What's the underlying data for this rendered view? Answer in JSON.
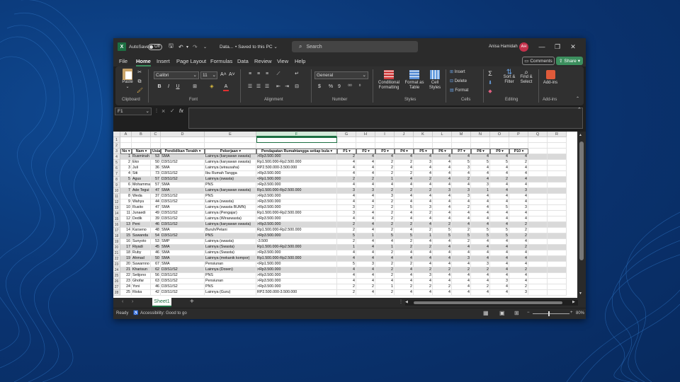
{
  "window": {
    "autosave_label": "AutoSave",
    "autosave_state": "Off",
    "file_name": "Data...",
    "save_status": "Saved to this PC",
    "search_placeholder": "Search",
    "user_name": "Anisa Hamidah",
    "user_initials": "AH"
  },
  "menu": {
    "tabs": [
      "File",
      "Home",
      "Insert",
      "Page Layout",
      "Formulas",
      "Data",
      "Review",
      "View",
      "Help"
    ],
    "active_tab": "Home",
    "comments_label": "Comments",
    "share_label": "Share"
  },
  "ribbon": {
    "clipboard": {
      "paste": "Paste",
      "label": "Clipboard"
    },
    "font": {
      "name": "Calibri",
      "size": "11",
      "label": "Font",
      "bold": "B",
      "italic": "I",
      "underline": "U"
    },
    "alignment": {
      "label": "Alignment"
    },
    "number": {
      "format": "General",
      "currency": "$",
      "percent": "%",
      "comma": "9",
      "label": "Number"
    },
    "styles": {
      "conditional": "Conditional Formatting",
      "format_table": "Format as Table",
      "cell_styles": "Cell Styles",
      "label": "Styles"
    },
    "cells": {
      "insert": "Insert",
      "delete": "Delete",
      "format": "Format",
      "label": "Cells"
    },
    "editing": {
      "sum": "Σ",
      "sort": "Sort & Filter",
      "find": "Find & Select",
      "label": "Editing"
    },
    "addins": {
      "button": "Add-ins",
      "label": "Add-ins"
    }
  },
  "formula_bar": {
    "name_box": "F1",
    "cancel": "×",
    "enter": "✓",
    "fx": "fx",
    "value": ""
  },
  "sheet": {
    "columns": [
      "A",
      "B",
      "C",
      "D",
      "E",
      "F",
      "G",
      "H",
      "I",
      "J",
      "K",
      "L",
      "M",
      "N",
      "O",
      "P",
      "Q",
      "R"
    ],
    "selected_column": "F",
    "header": [
      "No",
      "Nam",
      "Usia",
      "Pendidikan Terakh",
      "Pekerjaan",
      "Pendapatan Rumahtangga setiap bula",
      "P1",
      "P2",
      "P3",
      "P4",
      "P5",
      "P6",
      "P7",
      "P8",
      "P9",
      "P10"
    ],
    "rows": [
      [
        "1",
        "Rusminah",
        "53",
        "SMA",
        "Lainnya (karyawan swasta)",
        ">Rp3.500.000",
        "2",
        "4",
        "4",
        "4",
        "4",
        "4",
        "4",
        "4",
        "4",
        "4"
      ],
      [
        "2",
        "Eko",
        "50",
        "D3/S1/S2",
        "Lainnya (karyawan swasta)",
        "Rp1.500.000-Rp2.500.000",
        "4",
        "4",
        "2",
        "2",
        "3",
        "4",
        "5",
        "5",
        "5",
        "2"
      ],
      [
        "3",
        "Juli",
        "36",
        "SMA",
        "Lainnya (wirausaha)",
        "RP2.500.000-3.500.000",
        "4",
        "4",
        "2",
        "4",
        "4",
        "4",
        "3",
        "4",
        "4",
        "4"
      ],
      [
        "4",
        "Siti",
        "73",
        "D3/S1/S2",
        "Ibu Rumah Tangga",
        ">Rp3.500.000",
        "4",
        "4",
        "2",
        "2",
        "4",
        "4",
        "4",
        "4",
        "4",
        "4"
      ],
      [
        "5",
        "Agus",
        "57",
        "D3/S1/S2",
        "Lainnya (swasta)",
        "<Rp1.500.000",
        "2",
        "2",
        "1",
        "4",
        "2",
        "4",
        "2",
        "4",
        "2",
        "4"
      ],
      [
        "6",
        "Mohamma",
        "57",
        "SMA",
        "PNS",
        ">Rp3.500.000",
        "4",
        "4",
        "4",
        "4",
        "4",
        "4",
        "4",
        "3",
        "4",
        "4"
      ],
      [
        "7",
        "Ade Tegui",
        "47",
        "SMA",
        "Lainnya (karyawan swasta)",
        "Rp1.500.000-Rp2.500.000",
        "3",
        "3",
        "2",
        "2",
        "2",
        "3",
        "3",
        "1",
        "4",
        "3"
      ],
      [
        "8",
        "Weda",
        "37",
        "D3/S1/S2",
        "PNS",
        ">Rp3.500.000",
        "4",
        "4",
        "3",
        "4",
        "4",
        "4",
        "3",
        "4",
        "4",
        "4"
      ],
      [
        "9",
        "Wahyu",
        "44",
        "D3/S1/S2",
        "Lainnya (swasta)",
        ">Rp3.500.000",
        "4",
        "4",
        "2",
        "4",
        "4",
        "4",
        "4",
        "4",
        "4",
        "4"
      ],
      [
        "10",
        "Rusito",
        "47",
        "SMA",
        "Lainnya (swasta BUMN)",
        ">Rp3.500.000",
        "3",
        "2",
        "2",
        "5",
        "3",
        "4",
        "2",
        "4",
        "5",
        "3"
      ],
      [
        "11",
        "Junaedi",
        "49",
        "D3/S1/S2",
        "Lainnya (Pengajar)",
        "Rp1.500.000-Rp2.500.000",
        "3",
        "4",
        "2",
        "4",
        "2",
        "4",
        "4",
        "4",
        "4",
        "4"
      ],
      [
        "12",
        "Dedik",
        "39",
        "D3/S1/S2",
        "Lainnya (Wiraswasta)",
        ">Rp3.500.000",
        "4",
        "4",
        "2",
        "4",
        "4",
        "4",
        "4",
        "4",
        "4",
        "4"
      ],
      [
        "13",
        "Peni",
        "46",
        "D3/S1/S2",
        "Lainnya (karyawan swasta)",
        ">Rp3.500.000",
        "2",
        "4",
        "2",
        "2",
        "4",
        "2",
        "4",
        "4",
        "4",
        "2"
      ],
      [
        "14",
        "Karseno",
        "48",
        "SMA",
        "Buruh/Petani",
        "Rp1.500.000-Rp2.500.000",
        "2",
        "4",
        "2",
        "4",
        "2",
        "5",
        "2",
        "5",
        "5",
        "2"
      ],
      [
        "15",
        "Suwanda",
        "54",
        "D3/S1/S2",
        "PNS",
        ">Rp3.500.000",
        "5",
        "1",
        "5",
        "5",
        "1",
        "5",
        "5",
        "5",
        "5",
        "2"
      ],
      [
        "16",
        "Sunyoto",
        "53",
        "SMP",
        "Lainnya (swasta)",
        "-3.500",
        "2",
        "4",
        "4",
        "2",
        "4",
        "4",
        "2",
        "4",
        "4",
        "4"
      ],
      [
        "17",
        "Riyadi",
        "45",
        "SMA",
        "Lainnya (Swasta)",
        "Rp1.500.000-Rp2.500.000",
        "1",
        "4",
        "1",
        "2",
        "2",
        "4",
        "4",
        "4",
        "4",
        "2"
      ],
      [
        "18",
        "Ruby",
        "46",
        "SMA",
        "Lainnya (Swasta)",
        ">Rp3.500.000",
        "4",
        "4",
        "2",
        "4",
        "4",
        "4",
        "4",
        "4",
        "4",
        "4"
      ],
      [
        "19",
        "Ahmad",
        "50",
        "SMA",
        "Lainnya (mekanik kompor)",
        "Rp1.500.000-Rp2.500.000",
        "4",
        "4",
        "4",
        "4",
        "4",
        "4",
        "3",
        "4",
        "4",
        "4"
      ],
      [
        "20",
        "Suwarnno",
        "67",
        "SMA",
        "Pensiunan",
        "<Rp1.500.000",
        "5",
        "3",
        "2",
        "2",
        "4",
        "4",
        "4",
        "3",
        "4",
        "4"
      ],
      [
        "21",
        "Kharisun",
        "62",
        "D3/S1/S2",
        "Lainnya (Dosen)",
        ">Rp3.500.000",
        "4",
        "4",
        "2",
        "4",
        "2",
        "2",
        "2",
        "2",
        "4",
        "2"
      ],
      [
        "22",
        "Setijono",
        "56",
        "D3/S1/S2",
        "PNS",
        ">Rp3.500.000",
        "4",
        "4",
        "2",
        "4",
        "3",
        "4",
        "4",
        "4",
        "4",
        "4"
      ],
      [
        "23",
        "Ghofar",
        "63",
        "D3/S1/S2",
        "Pensiunan",
        ">Rp3.500.000",
        "4",
        "4",
        "4",
        "4",
        "4",
        "4",
        "4",
        "4",
        "3",
        "4"
      ],
      [
        "24",
        "Yoni",
        "46",
        "D3/S1/S2",
        "PNS",
        ">Rp3.500.000",
        "2",
        "2",
        "1",
        "2",
        "2",
        "2",
        "4",
        "2",
        "4",
        "2"
      ],
      [
        "25",
        "Riska",
        "42",
        "D3/S1/S2",
        "Lainnya (Guru)",
        "RP2.500.000-3.500.000",
        "2",
        "4",
        "2",
        "4",
        "4",
        "4",
        "4",
        "4",
        "4",
        "3"
      ]
    ],
    "shaded_rows": [
      0,
      4,
      6,
      12,
      14,
      16,
      18,
      20
    ]
  },
  "sheet_tabs": {
    "active": "Sheet1",
    "add": "+"
  },
  "status": {
    "ready": "Ready",
    "accessibility": "Accessibility: Good to go",
    "zoom": "80%"
  }
}
